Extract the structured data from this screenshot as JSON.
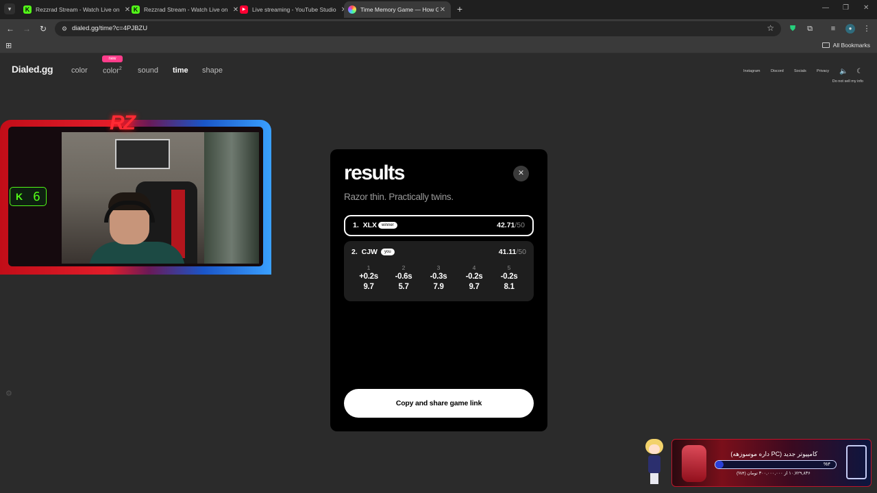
{
  "browser": {
    "tabs": [
      {
        "title": "Rezzrad Stream - Watch Live on",
        "favicon": "kick-icon"
      },
      {
        "title": "Rezzrad Stream - Watch Live on",
        "favicon": "kick-icon"
      },
      {
        "title": "Live streaming - YouTube Studio",
        "favicon": "youtube-icon"
      },
      {
        "title": "Time Memory Game — How G",
        "favicon": "dialed-icon",
        "active": true
      }
    ],
    "url": "dialed.gg/time?c=4PJBZU",
    "bookmarks_label": "All Bookmarks"
  },
  "site": {
    "logo": "Dialed.gg",
    "nav": [
      {
        "label": "color"
      },
      {
        "label": "color",
        "sup": "2",
        "badge": "new"
      },
      {
        "label": "sound"
      },
      {
        "label": "time",
        "active": true
      },
      {
        "label": "shape"
      }
    ],
    "top_links": [
      "Instagram",
      "Discord",
      "Socials",
      "Privacy"
    ],
    "do_not_sell": "Do not sell my info"
  },
  "webcam": {
    "logo_text": "RZ",
    "kick_count": "6"
  },
  "results": {
    "title": "results",
    "subtitle": "Razor thin. Practically twins.",
    "players": [
      {
        "rank": "1.",
        "name": "XLX",
        "badge": "winner",
        "score": "42.71",
        "out_of": "/50"
      },
      {
        "rank": "2.",
        "name": "CJW",
        "badge": "you",
        "score": "41.11",
        "out_of": "/50",
        "rounds": [
          {
            "index": "1",
            "diff": "+0.2s",
            "points": "9.7"
          },
          {
            "index": "2",
            "diff": "-0.6s",
            "points": "5.7"
          },
          {
            "index": "3",
            "diff": "-0.3s",
            "points": "7.9"
          },
          {
            "index": "4",
            "diff": "-0.2s",
            "points": "9.7"
          },
          {
            "index": "5",
            "diff": "-0.2s",
            "points": "8.1"
          }
        ]
      }
    ],
    "share_label": "Copy and share game link"
  },
  "donation": {
    "title": "کامپیوتر جدید (PC داره موسوزهه)",
    "percent": "%۴",
    "progress": 0.04,
    "subtitle": "۱۰,۷۲۹,۸۳۶ از ۳۰۰,۰۰۰,۰۰۰ تومان (۴%)"
  },
  "colors": {
    "accent_pink": "#ff3d8b",
    "kick_green": "#53fc18"
  }
}
